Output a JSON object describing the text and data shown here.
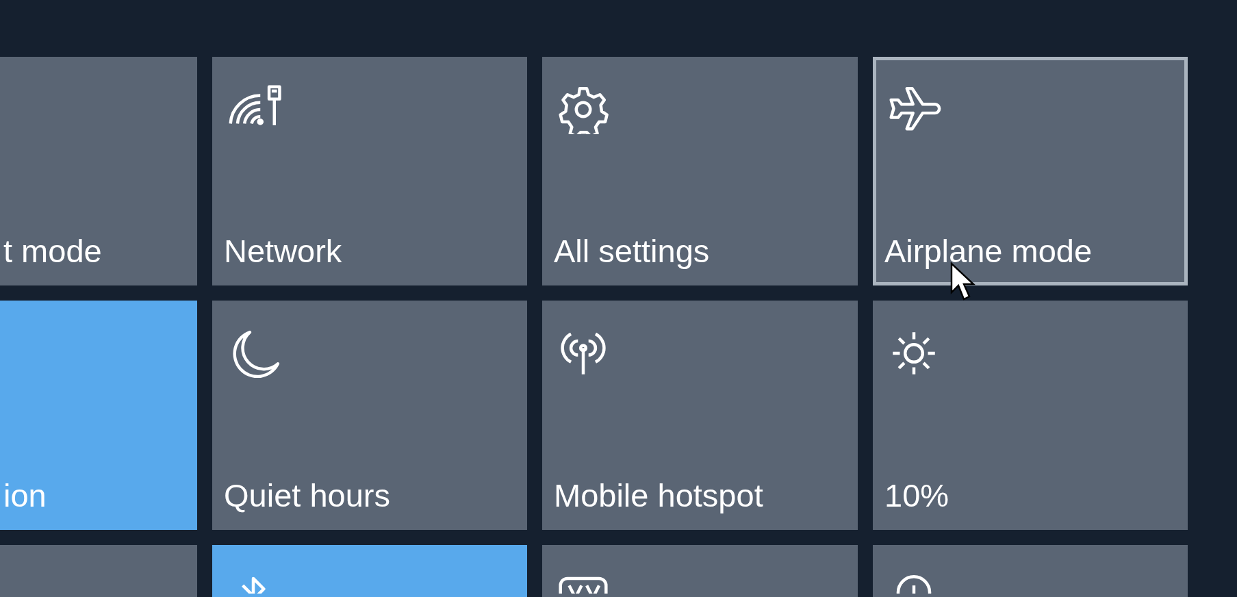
{
  "tiles": [
    {
      "label": "t mode",
      "kind": "none",
      "active": false,
      "hovered": false
    },
    {
      "label": "Network",
      "kind": "network",
      "active": false,
      "hovered": false
    },
    {
      "label": "All settings",
      "kind": "settings",
      "active": false,
      "hovered": false
    },
    {
      "label": "Airplane mode",
      "kind": "airplane",
      "active": false,
      "hovered": true
    },
    {
      "label": "ion",
      "kind": "none",
      "active": true,
      "hovered": false
    },
    {
      "label": "Quiet hours",
      "kind": "moon",
      "active": false,
      "hovered": false
    },
    {
      "label": "Mobile hotspot",
      "kind": "hotspot",
      "active": false,
      "hovered": false
    },
    {
      "label": "10%",
      "kind": "brightness",
      "active": false,
      "hovered": false
    },
    {
      "kind": "none",
      "active": false,
      "hovered": false
    },
    {
      "kind": "bluetooth",
      "active": true,
      "hovered": false
    },
    {
      "kind": "vpn",
      "active": false,
      "hovered": false
    },
    {
      "kind": "location",
      "active": false,
      "hovered": false
    }
  ]
}
